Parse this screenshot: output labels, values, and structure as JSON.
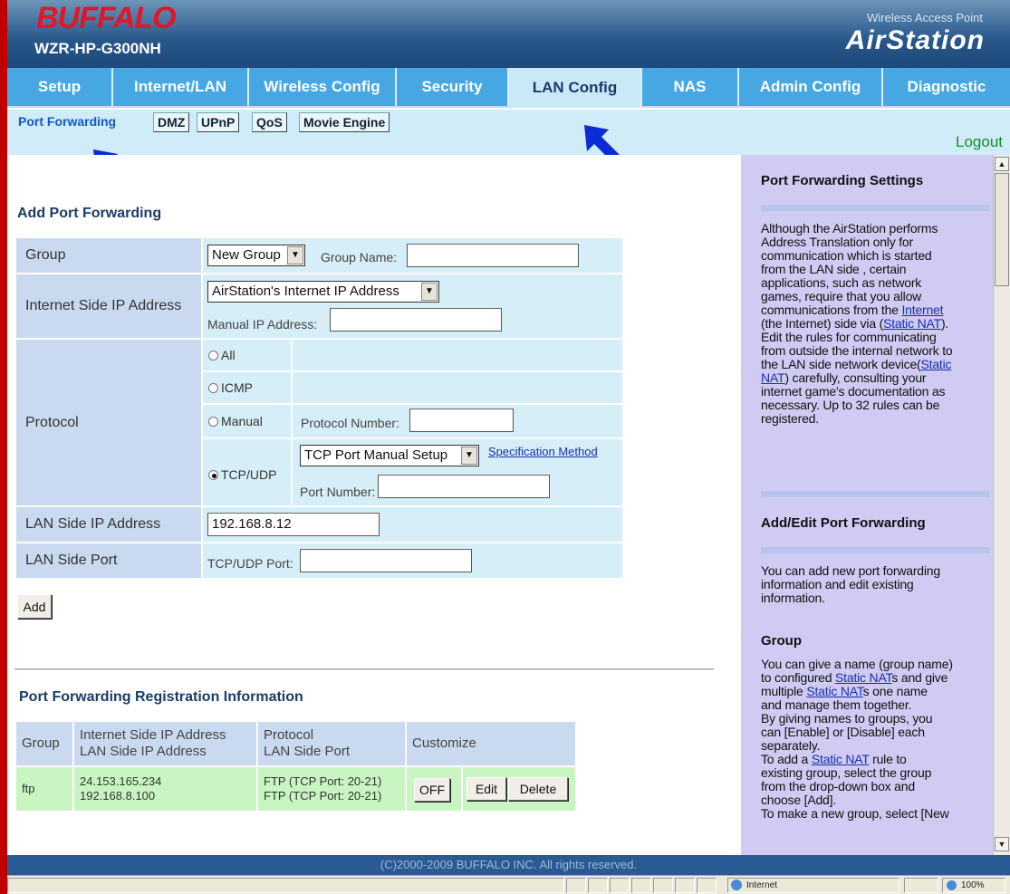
{
  "header": {
    "brand": "BUFFALO",
    "model": "WZR-HP-G300NH",
    "product_type": "Wireless Access Point",
    "product_name": "AirStation"
  },
  "nav": {
    "tabs": [
      {
        "label": "Setup"
      },
      {
        "label": "Internet/LAN"
      },
      {
        "label": "Wireless Config"
      },
      {
        "label": "Security"
      },
      {
        "label": "LAN Config"
      },
      {
        "label": "NAS"
      },
      {
        "label": "Admin Config"
      },
      {
        "label": "Diagnostic"
      }
    ],
    "active_tab": "LAN Config"
  },
  "subnav": {
    "tabs": [
      {
        "label": "Port Forwarding"
      },
      {
        "label": "DMZ"
      },
      {
        "label": "UPnP"
      },
      {
        "label": "QoS"
      },
      {
        "label": "Movie Engine"
      }
    ],
    "active_tab": "Port Forwarding",
    "logout": "Logout"
  },
  "form": {
    "title": "Add Port Forwarding",
    "group_label": "Group",
    "group_select": "New Group",
    "group_name_label": "Group Name:",
    "group_name_value": "",
    "internet_ip_label": "Internet Side IP Address",
    "internet_ip_select": "AirStation's Internet IP Address",
    "manual_ip_label": "Manual IP Address:",
    "manual_ip_value": "",
    "protocol_label": "Protocol",
    "protocol_options": [
      "All",
      "ICMP",
      "Manual",
      "TCP/UDP"
    ],
    "protocol_selected": "TCP/UDP",
    "protocol_number_label": "Protocol Number:",
    "tcp_select": "TCP Port Manual Setup",
    "spec_method_link": "Specification Method",
    "port_number_label": "Port Number:",
    "lan_ip_label": "LAN Side IP Address",
    "lan_ip_value": "192.168.8.12",
    "lan_port_label": "LAN Side Port",
    "tcp_udp_port_label": "TCP/UDP Port:",
    "add_button": "Add"
  },
  "registration": {
    "title": "Port Forwarding Registration Information",
    "headers": {
      "group": "Group",
      "ip_1": "Internet Side IP Address",
      "ip_2": "LAN Side IP Address",
      "proto_1": "Protocol",
      "proto_2": "LAN Side Port",
      "customize": "Customize"
    },
    "rows": [
      {
        "group": "ftp",
        "internet_ip": "24.153.165.234",
        "lan_ip": "192.168.8.100",
        "protocol": "FTP (TCP Port: 20-21)",
        "lan_port": "FTP (TCP Port: 20-21)",
        "toggle": "OFF",
        "edit": "Edit",
        "delete": "Delete"
      }
    ]
  },
  "sidebar": {
    "s1_title": "Port Forwarding Settings",
    "s1_l1": "Although the AirStation performs",
    "s1_l2": "Address Translation only for",
    "s1_l3": "communication which is started",
    "s1_l4": "from the LAN side , certain",
    "s1_l5": "applications, such as network",
    "s1_l6": "games, require that you allow",
    "s1_l7a": "communications from the ",
    "s1_l7_link": "Internet",
    "s1_l8a": "(the Internet) side via (",
    "s1_l8_link": "Static NAT",
    "s1_l8b": ").",
    "s1_l9": "Edit the rules for communicating",
    "s1_l10": "from outside the internal network to",
    "s1_l11a": "the LAN side network device(",
    "s1_l11_link": "Static",
    "s1_l12_link": "NAT",
    "s1_l12b": ") carefully, consulting your",
    "s1_l13": "internet game's documentation as",
    "s1_l14": "necessary. Up to 32 rules can be",
    "s1_l15": "registered.",
    "s2_title": "Add/Edit Port Forwarding",
    "s2_l1": "You can add new port forwarding",
    "s2_l2": "information and edit existing",
    "s2_l3": "information.",
    "s3_title": "Group",
    "s3_l1": "You can give a name (group name)",
    "s3_l2a": "to configured ",
    "s3_l2_link": "Static NAT",
    "s3_l2b": "s and give",
    "s3_l3a": "multiple ",
    "s3_l3_link": "Static NAT",
    "s3_l3b": "s one name",
    "s3_l4": "and manage them together.",
    "s3_l5": "By giving names to groups, you",
    "s3_l6": "can [Enable] or [Disable] each",
    "s3_l7": "separately.",
    "s3_l8a": "To add a ",
    "s3_l8_link": "Static NAT",
    "s3_l8b": " rule to",
    "s3_l9": "existing group, select the group",
    "s3_l10": "from the drop-down box and",
    "s3_l11": "choose [Add].",
    "s3_l12": "To make a new group, select [New"
  },
  "footer": {
    "copyright": "(C)2000-2009 BUFFALO INC. All rights reserved."
  },
  "statusbar": {
    "zone": "Internet",
    "zoom": "100%"
  },
  "colors": {
    "nav_bg": "#46a7e2",
    "active_tab_bg": "#c9e9f7",
    "label_bg": "#c9d9ef",
    "value_bg": "#d6eef7",
    "row_bg": "#c8f5c1",
    "sidebar_bg": "#cfcbf2",
    "frame_border": "#c00000",
    "arrow": "#0b2bd4"
  }
}
